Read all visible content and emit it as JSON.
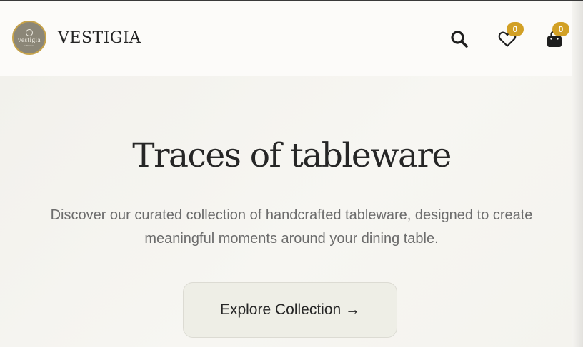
{
  "header": {
    "brand_name": "VESTIGIA",
    "logo_text": "vestigia",
    "logo_subtext": "tableware",
    "wishlist_count": "0",
    "cart_count": "0",
    "icons": [
      "search-icon",
      "heart-icon",
      "shopping-bag-icon"
    ]
  },
  "hero": {
    "title": "Traces of tableware",
    "subtitle_line1": "Discover our curated collection of handcrafted tableware, designed to create",
    "subtitle_line2": "meaningful moments around your dining table.",
    "cta_label": "Explore Collection →"
  },
  "colors": {
    "accent_badge": "#d2a025",
    "logo_ring": "#c6a24a",
    "text_dark": "#262626",
    "text_muted": "#6c6c6c",
    "button_bg": "#eeeee6"
  }
}
